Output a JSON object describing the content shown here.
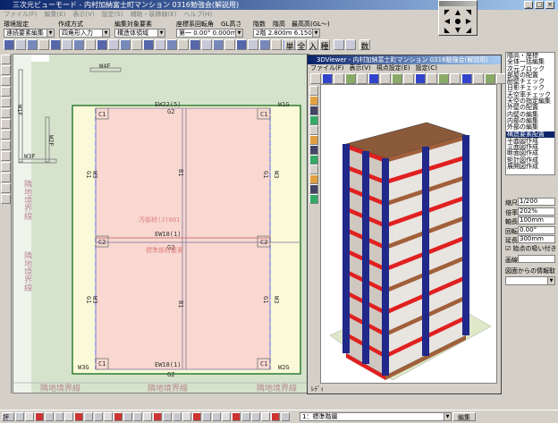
{
  "window": {
    "title": "三次元ビューモード - 内村加納富士町マンション 0316勉強会(解説用)",
    "controls": [
      "_",
      "□",
      "×"
    ]
  },
  "menu": [
    "ファイル(F)",
    "編集(E)",
    "表示(V)",
    "設定(S)",
    "補助・装飾線(E)",
    "ヘルプ(H)"
  ],
  "settings": {
    "labels": [
      "環境設定",
      "作成方式",
      "編集対象要素",
      "座標系",
      "回転角",
      "GL高さ",
      "階数",
      "階高",
      "最高高(GL〜)"
    ],
    "env": "連続要素編集",
    "method": "四角形入力",
    "target": "構造体領域",
    "coord": "第一",
    "angle": "0.00°",
    "gl": "0.000m",
    "floor": "2階",
    "floor_height": "2.800m",
    "max_height": "6.150m"
  },
  "toolbar_text": [
    "単",
    "全",
    "入",
    "種",
    "数"
  ],
  "plan": {
    "labels": [
      "W4F",
      "W1F",
      "W2F",
      "W3F",
      "EW22(5)",
      "G2",
      "W1G",
      "C1",
      "C1",
      "G1",
      "W3",
      "B1",
      "G1",
      "W3",
      "C2",
      "C2",
      "EW18(1)",
      "G2",
      "G1",
      "W3",
      "B1",
      "G1",
      "W3",
      "C1",
      "C1",
      "W3G",
      "W2G",
      "EW18(1)",
      "G2"
    ],
    "overlay": [
      "汚部材(J)001",
      "標準部材要素"
    ],
    "boundary": [
      "隣地境界線",
      "隣地境界線",
      "隣地境界線",
      "隣地境界線",
      "隣地境界線"
    ]
  },
  "viewer": {
    "title": "3DViewer - 内村加納富士町マンション 0316勉強会(解説用)",
    "menu": [
      "ファイル(F)",
      "表示(V)",
      "視点設定(E)",
      "設定(C)"
    ],
    "status": "ﾚﾃﾞｨ"
  },
  "side_list": {
    "items": [
      "階高・座標",
      "全体一括編集",
      "次元ブロック",
      "部屋の配置",
      "耐壁チェック",
      "日影チェック",
      "天空率チェック",
      "天空の指定編集",
      "外壁の配置",
      "内壁の編集",
      "内部の編集",
      "外部の編集",
      "構造要素配置",
      "平面図作成",
      "立面図作成",
      "断面図作成",
      "矩計図作成",
      "展開図作成"
    ],
    "selected": "構造要素配置"
  },
  "side_fields": [
    {
      "label": "縮尺",
      "value": "1/200"
    },
    {
      "label": "倍率",
      "value": "202%"
    },
    {
      "label": "軸長",
      "value": "100mm"
    },
    {
      "label": "回転",
      "value": "0.00°"
    },
    {
      "label": "延長",
      "value": "300mm"
    }
  ],
  "snap_label": "始点の吸い付き",
  "snap_checked": true,
  "line_label": "画線",
  "line_value": "",
  "info_label": "図面からの情報取得",
  "info_value": "",
  "bottom": {
    "layer": "1：標準階層",
    "edit_button": "編集",
    "mode_label": "評"
  }
}
